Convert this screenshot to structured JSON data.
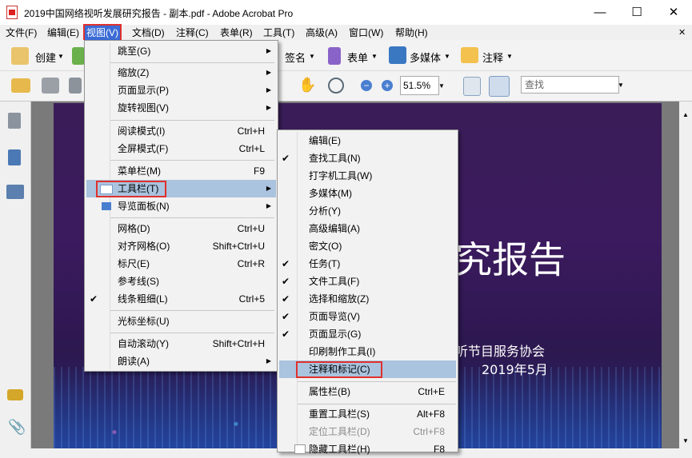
{
  "window": {
    "title": "2019中国网络视听发展研究报告 - 副本.pdf - Adobe Acrobat Pro",
    "minimize": "—",
    "maximize": "☐",
    "close": "✕"
  },
  "menubar": [
    "文件(F)",
    "编辑(E)",
    "视图(V)",
    "文档(D)",
    "注释(C)",
    "表单(R)",
    "工具(T)",
    "高级(A)",
    "窗口(W)",
    "帮助(H)"
  ],
  "menubar_active": "视图(V)",
  "toolbar1": {
    "create": "创建",
    "sign": "签名",
    "form": "表单",
    "multimedia": "多媒体",
    "comment": "注释"
  },
  "toolbar2": {
    "zoom": "51.5%",
    "search_placeholder": "查找"
  },
  "document": {
    "title_fragment": "究报告",
    "org_fragment": "听节目服务协会",
    "date": "2019年5月"
  },
  "view_menu": {
    "items": [
      {
        "label": "跳至(G)",
        "arrow": true
      },
      {
        "sep": true
      },
      {
        "label": "缩放(Z)",
        "arrow": true
      },
      {
        "label": "页面显示(P)",
        "arrow": true
      },
      {
        "label": "旋转视图(V)",
        "arrow": true
      },
      {
        "sep": true
      },
      {
        "label": "阅读模式(I)",
        "shortcut": "Ctrl+H"
      },
      {
        "label": "全屏模式(F)",
        "shortcut": "Ctrl+L"
      },
      {
        "sep": true
      },
      {
        "label": "菜单栏(M)",
        "shortcut": "F9"
      },
      {
        "label": "工具栏(T)",
        "arrow": true,
        "highlight": true
      },
      {
        "label": "导览面板(N)",
        "arrow": true
      },
      {
        "sep": true
      },
      {
        "label": "网格(D)",
        "shortcut": "Ctrl+U"
      },
      {
        "label": "对齐网格(O)",
        "shortcut": "Shift+Ctrl+U"
      },
      {
        "label": "标尺(E)",
        "shortcut": "Ctrl+R"
      },
      {
        "label": "参考线(S)"
      },
      {
        "label": "线条粗细(L)",
        "shortcut": "Ctrl+5",
        "check": true
      },
      {
        "sep": true
      },
      {
        "label": "光标坐标(U)"
      },
      {
        "sep": true
      },
      {
        "label": "自动滚动(Y)",
        "shortcut": "Shift+Ctrl+H"
      },
      {
        "label": "朗读(A)",
        "arrow": true
      }
    ]
  },
  "toolbar_submenu": {
    "items": [
      {
        "label": "编辑(E)"
      },
      {
        "label": "查找工具(N)",
        "check": true
      },
      {
        "label": "打字机工具(W)"
      },
      {
        "label": "多媒体(M)"
      },
      {
        "label": "分析(Y)"
      },
      {
        "label": "高级编辑(A)"
      },
      {
        "label": "密文(O)"
      },
      {
        "label": "任务(T)",
        "check": true
      },
      {
        "label": "文件工具(F)",
        "check": true
      },
      {
        "label": "选择和缩放(Z)",
        "check": true
      },
      {
        "label": "页面导览(V)",
        "check": true
      },
      {
        "label": "页面显示(G)",
        "check": true
      },
      {
        "label": "印刷制作工具(I)"
      },
      {
        "label": "注释和标记(C)",
        "highlight": true
      },
      {
        "sep": true
      },
      {
        "label": "属性栏(B)",
        "shortcut": "Ctrl+E"
      },
      {
        "sep": true
      },
      {
        "label": "重置工具栏(S)",
        "shortcut": "Alt+F8"
      },
      {
        "label": "定位工具栏(D)",
        "shortcut": "Ctrl+F8",
        "disabled": true
      },
      {
        "label": "隐藏工具栏(H)",
        "shortcut": "F8"
      }
    ]
  },
  "colors": {
    "menu_highlight": "#aac3de",
    "red_box": "#e0312e",
    "menubar_active": "#3b6bd6",
    "doc_bg": "#3a1d58"
  }
}
